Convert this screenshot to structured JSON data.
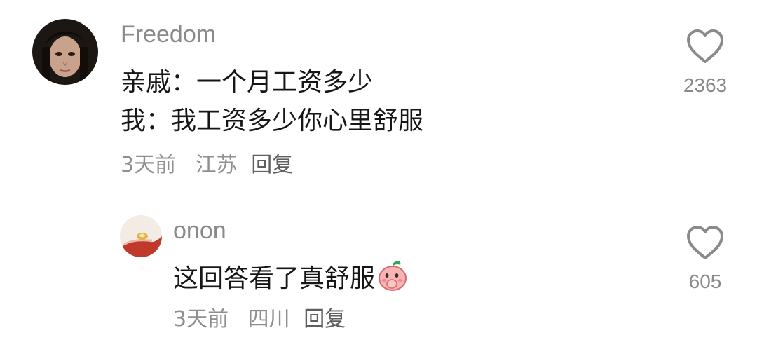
{
  "comments": [
    {
      "username": "Freedom",
      "text_lines": [
        "亲戚：一个月工资多少",
        "我：我工资多少你心里舒服"
      ],
      "time": "3天前",
      "location": "江苏",
      "reply_label": "回复",
      "likes": "2363",
      "avatar_icon": "user-avatar-portrait",
      "like_icon": "heart-outline-icon"
    },
    {
      "username": "onon",
      "text": "这回答看了真舒服",
      "emoji_icon": "peach-covering-mouth-emoji",
      "time": "3天前",
      "location": "四川",
      "reply_label": "回复",
      "likes": "605",
      "avatar_icon": "hand-holding-ring-avatar",
      "like_icon": "heart-outline-icon"
    }
  ],
  "colors": {
    "text_primary": "#161616",
    "text_secondary": "#8a8a8a",
    "reply": "#5f5f5f",
    "heart_stroke": "#8a8a8a",
    "background": "#ffffff"
  }
}
